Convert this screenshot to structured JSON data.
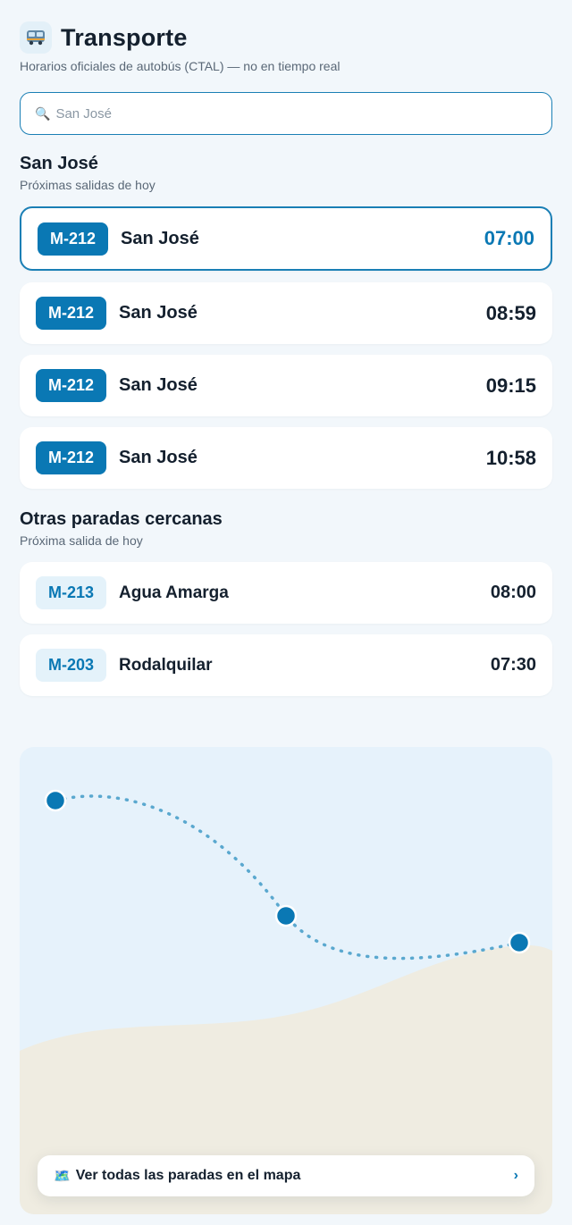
{
  "header": {
    "app_icon": "bus-icon",
    "title": "Transporte",
    "subtitle": "Horarios oficiales de autobús (CTAL) — no en tiempo real"
  },
  "search": {
    "placeholder": "San José",
    "value": ""
  },
  "current_stop": {
    "title": "San José",
    "subtitle": "Próximas salidas de hoy",
    "departures": [
      {
        "route": "M-212",
        "destination": "San José",
        "time": "07:00",
        "selected": true
      },
      {
        "route": "M-212",
        "destination": "San José",
        "time": "08:59"
      },
      {
        "route": "M-212",
        "destination": "San José",
        "time": "09:15"
      },
      {
        "route": "M-212",
        "destination": "San José",
        "time": "10:58"
      }
    ]
  },
  "nearby": {
    "title": "Otras paradas cercanas",
    "subtitle": "Próxima salida de hoy",
    "stops": [
      {
        "route": "M-213",
        "destination": "Agua Amarga",
        "time": "08:00"
      },
      {
        "route": "M-203",
        "destination": "Rodalquilar",
        "time": "07:30"
      }
    ]
  },
  "map": {
    "button_label": "Ver todas las paradas en el mapa",
    "button_icon": "map-icon",
    "colors": {
      "water": "#e6f2fb",
      "land": "#efece1",
      "route": "#5aa8cf",
      "stop": "#0a78b4"
    }
  },
  "colors": {
    "accent": "#0a78b4",
    "background": "#f2f7fb"
  }
}
